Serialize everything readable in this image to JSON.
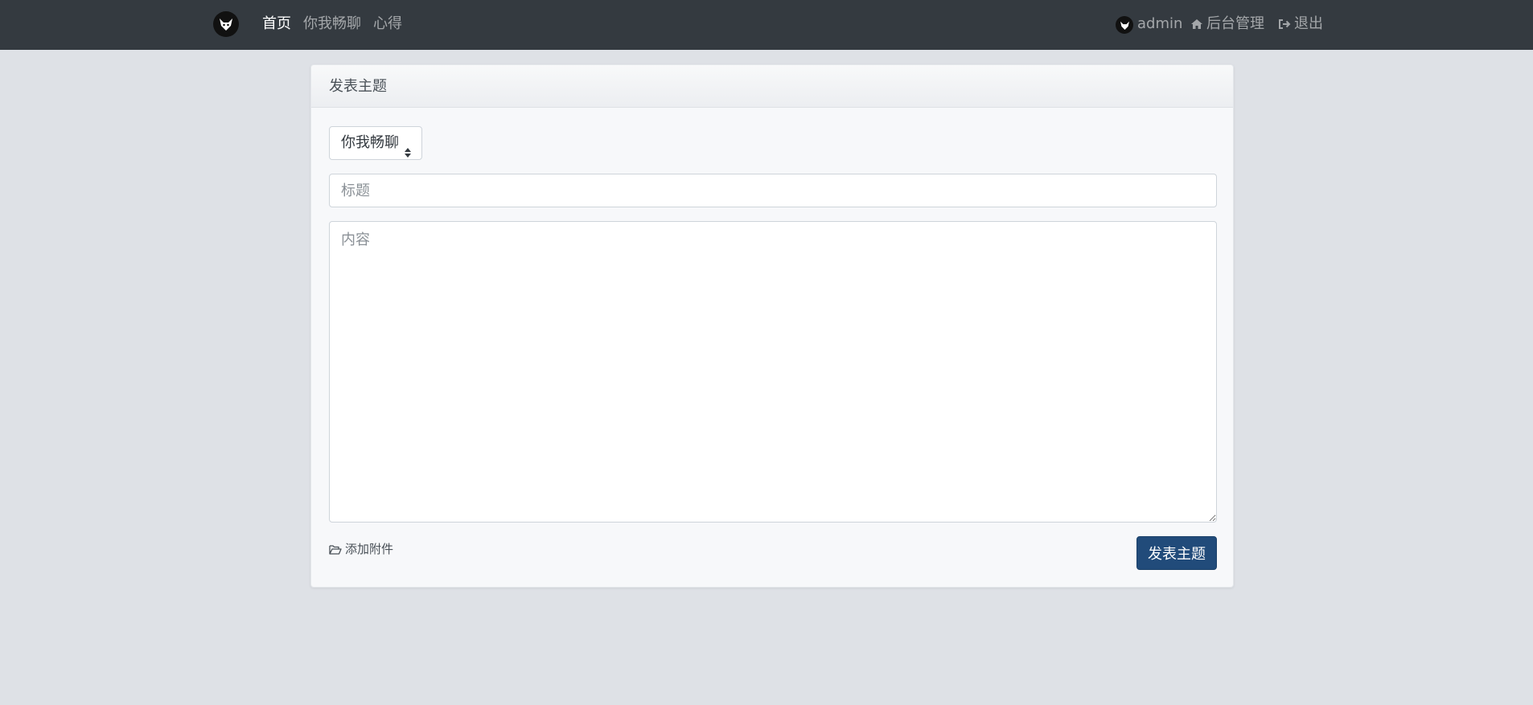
{
  "nav": {
    "links": [
      {
        "label": "首页",
        "active": true
      },
      {
        "label": "你我畅聊",
        "active": false
      },
      {
        "label": "心得",
        "active": false
      }
    ],
    "user": "admin",
    "admin_label": "后台管理",
    "logout_label": "退出"
  },
  "form": {
    "header": "发表主题",
    "category_selected": "你我畅聊",
    "title_placeholder": "标题",
    "content_placeholder": "内容",
    "attach_label": "添加附件",
    "submit_label": "发表主题"
  },
  "colors": {
    "navbar": "#343a40",
    "background": "#dee1e6",
    "primary_button": "#214b7a"
  },
  "icons": [
    "logo-icon",
    "avatar-icon",
    "home-icon",
    "sign-out-icon",
    "sort-icon",
    "folder-open-icon"
  ]
}
